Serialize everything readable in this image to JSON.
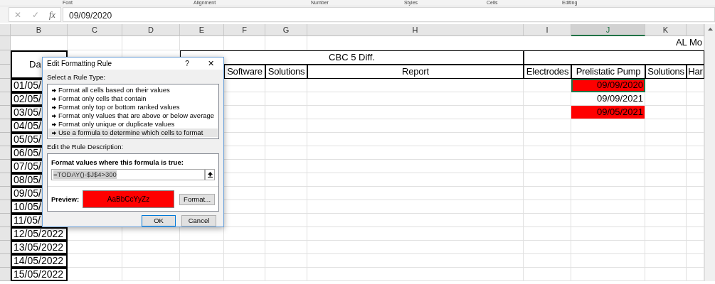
{
  "ribbon_groups": [
    "Font",
    "Alignment",
    "Number",
    "Styles",
    "Cells",
    "Editing"
  ],
  "formula_bar": {
    "cancel": "✕",
    "enter": "✓",
    "function": "fx",
    "value": "09/09/2020"
  },
  "columns": [
    {
      "label": "B",
      "selected": false
    },
    {
      "label": "C",
      "selected": false
    },
    {
      "label": "D",
      "selected": false
    },
    {
      "label": "E",
      "selected": false
    },
    {
      "label": "F",
      "selected": false
    },
    {
      "label": "G",
      "selected": false
    },
    {
      "label": "H",
      "selected": false
    },
    {
      "label": "I",
      "selected": false
    },
    {
      "label": "J",
      "selected": true
    },
    {
      "label": "K",
      "selected": false
    }
  ],
  "sheet": {
    "title_cell": "AL Mo",
    "date_header": "Da",
    "group_header": "CBC 5 Diff.",
    "headers": [
      "Software",
      "Solutions",
      "Report",
      "Electrodes",
      "Prelistatic Pump",
      "Solutions",
      "Har"
    ],
    "dates": [
      "01/05/",
      "02/05/",
      "03/05/",
      "04/05/",
      "05/05/",
      "06/05/",
      "07/05/",
      "08/05/",
      "09/05/",
      "10/05/",
      "11/05/",
      "12/05/2022",
      "13/05/2022",
      "14/05/2022",
      "15/05/2022"
    ],
    "pump_cells": [
      {
        "value": "09/09/2020",
        "highlight": true,
        "selected": true
      },
      {
        "value": "09/09/2021",
        "highlight": false,
        "selected": false
      },
      {
        "value": "09/05/2021",
        "highlight": true,
        "selected": false
      }
    ]
  },
  "dialog": {
    "title": "Edit Formatting Rule",
    "help": "?",
    "close": "✕",
    "rule_type_label": "Select a Rule Type:",
    "rule_types": [
      {
        "label": "Format all cells based on their values",
        "selected": false
      },
      {
        "label": "Format only cells that contain",
        "selected": false
      },
      {
        "label": "Format only top or bottom ranked values",
        "selected": false
      },
      {
        "label": "Format only values that are above or below average",
        "selected": false
      },
      {
        "label": "Format only unique or duplicate values",
        "selected": false
      },
      {
        "label": "Use a formula to determine which cells to format",
        "selected": true
      }
    ],
    "description_label": "Edit the Rule Description:",
    "formula_label": "Format values where this formula is true:",
    "formula": "=TODAY()-$J$4>300",
    "preview_label": "Preview:",
    "preview_text": "AaBbCcYyZz",
    "format_button": "Format...",
    "ok": "OK",
    "cancel": "Cancel"
  }
}
